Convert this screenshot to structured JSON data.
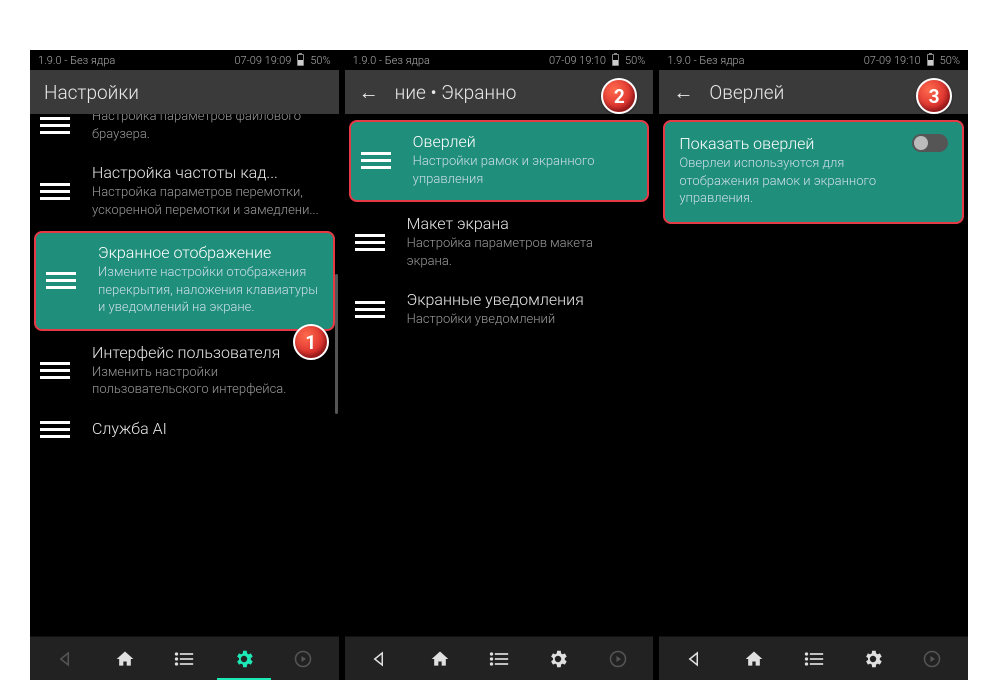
{
  "status": {
    "version": "1.9.0 - Без ядра",
    "time1": "07-09 19:09",
    "time2": "07-09 19:10",
    "battery": "50%"
  },
  "screen1": {
    "title": "Настройки",
    "items": [
      {
        "title": "",
        "desc": "Настройка параметров файлового браузера."
      },
      {
        "title": "Настройка частоты кад...",
        "desc": "Настройка параметров перемотки, ускоренной перемотки и замедлени..."
      },
      {
        "title": "Экранное отображение",
        "desc": "Измените настройки отображения перекрытия, наложения клавиатуры и уведомлений на экране."
      },
      {
        "title": "Интерфейс пользователя",
        "desc": "Изменить настройки пользовательского интерфейса."
      },
      {
        "title": "Служба AI",
        "desc": ""
      }
    ],
    "badge": "1"
  },
  "screen2": {
    "title_back": "←",
    "title": "ние   •   Экранно",
    "items": [
      {
        "title": "Оверлей",
        "desc": "Настройки рамок и экранного управления"
      },
      {
        "title": "Макет экрана",
        "desc": "Настройка параметров макета экрана."
      },
      {
        "title": "Экранные уведомления",
        "desc": "Настройки уведомлений"
      }
    ],
    "badge": "2"
  },
  "screen3": {
    "title": "Оверлей",
    "item": {
      "title": "Показать оверлей",
      "desc": "Оверлеи используются для отображения рамок и экранного управления."
    },
    "badge": "3"
  }
}
